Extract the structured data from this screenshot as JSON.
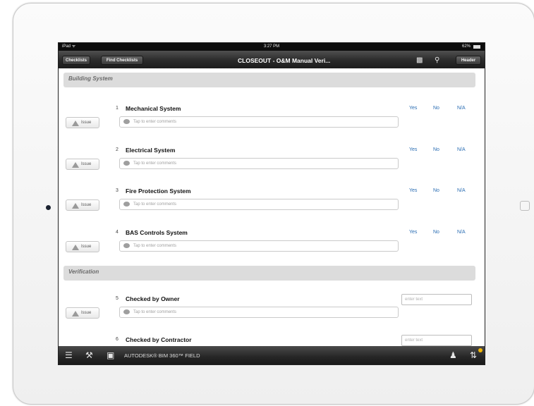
{
  "statusbar": {
    "device": "iPad",
    "wifi_icon": "wifi-icon",
    "time": "3:27 PM",
    "battery": "62%"
  },
  "navbar": {
    "checklists_button": "Checklists",
    "find_checklists_button": "Find Checklists",
    "title": "CLOSEOUT - O&M Manual Veri...",
    "header_button": "Header",
    "icons": [
      "clipboard-icon",
      "search-icon"
    ]
  },
  "sections": [
    {
      "title": "Building System"
    },
    {
      "title": "Verification"
    }
  ],
  "items": [
    {
      "number": "1",
      "title": "Mechanical System",
      "comment_placeholder": "Tap to enter comments",
      "issue_label": "Issue",
      "options": [
        "Yes",
        "No",
        "N/A"
      ]
    },
    {
      "number": "2",
      "title": "Electrical System",
      "comment_placeholder": "Tap to enter comments",
      "issue_label": "Issue",
      "options": [
        "Yes",
        "No",
        "N/A"
      ]
    },
    {
      "number": "3",
      "title": "Fire Protection System",
      "comment_placeholder": "Tap to enter comments",
      "issue_label": "Issue",
      "options": [
        "Yes",
        "No",
        "N/A"
      ]
    },
    {
      "number": "4",
      "title": "BAS Controls System",
      "comment_placeholder": "Tap to enter comments",
      "issue_label": "Issue",
      "options": [
        "Yes",
        "No",
        "N/A"
      ]
    },
    {
      "number": "5",
      "title": "Checked by Owner",
      "comment_placeholder": "Tap to enter comments",
      "issue_label": "Issue",
      "text_placeholder": "enter text"
    },
    {
      "number": "6",
      "title": "Checked by Contractor",
      "text_placeholder": "enter text"
    }
  ],
  "bottombar": {
    "brand": "AUTODESK® BIM 360™ FIELD",
    "icons": [
      "menu-icon",
      "tools-icon",
      "camera-icon",
      "user-icon",
      "sync-icon"
    ]
  },
  "colors": {
    "answer_blue": "#2a6db3",
    "notification": "#f2b705",
    "bar_dark": "#1c1c1c"
  }
}
